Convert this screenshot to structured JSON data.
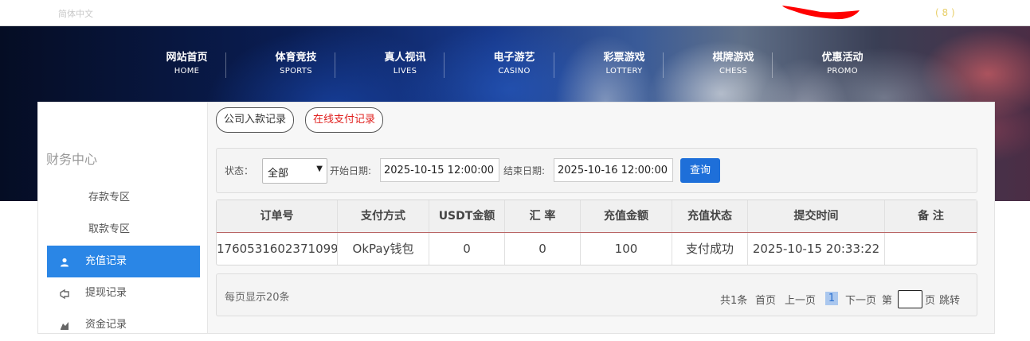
{
  "topbar": {
    "language": "简体中文",
    "badge": "( 8 )",
    "redaction_color": "#ff0000"
  },
  "nav": [
    {
      "cn": "网站首页",
      "en": "HOME"
    },
    {
      "cn": "体育竞技",
      "en": "SPORTS"
    },
    {
      "cn": "真人视讯",
      "en": "LIVES"
    },
    {
      "cn": "电子游艺",
      "en": "CASINO"
    },
    {
      "cn": "彩票游戏",
      "en": "LOTTERY"
    },
    {
      "cn": "棋牌游戏",
      "en": "CHESS"
    },
    {
      "cn": "优惠活动",
      "en": "PROMO"
    }
  ],
  "sidebar": {
    "title": "财务中心",
    "items": [
      {
        "label": "存款专区"
      },
      {
        "label": "取款专区"
      },
      {
        "label": "充值记录",
        "icon": "user-icon",
        "active": true
      },
      {
        "label": "提现记录",
        "icon": "withdraw-icon"
      },
      {
        "label": "资金记录",
        "icon": "funds-icon"
      }
    ]
  },
  "tabs": [
    {
      "label": "公司入款记录",
      "active": false
    },
    {
      "label": "在线支付记录",
      "active": true
    }
  ],
  "filter": {
    "status_label": "状态：",
    "status_value": "全部",
    "start_label": "开始日期:",
    "start_value": "2025-10-15 12:00:00",
    "end_label": "结束日期:",
    "end_value": "2025-10-16 12:00:00",
    "query_button": "查询"
  },
  "table": {
    "headers": [
      "订单号",
      "支付方式",
      "USDT金额",
      "汇 率",
      "充值金额",
      "充值状态",
      "提交时间",
      "备 注"
    ],
    "rows": [
      [
        "1760531602371099",
        "OkPay钱包",
        "0",
        "0",
        "100",
        "支付成功",
        "2025-10-15 20:33:22",
        ""
      ]
    ]
  },
  "pagination": {
    "per_page": "每页显示20条",
    "total": "共1条",
    "first": "首页",
    "prev": "上一页",
    "current": "1",
    "next": "下一页",
    "page_prefix": "第",
    "page_suffix": "页",
    "jump": "跳转"
  },
  "colors": {
    "accent": "#2a86e6",
    "query_button": "#1e6fd9",
    "active_tab_text": "#e0201e"
  }
}
